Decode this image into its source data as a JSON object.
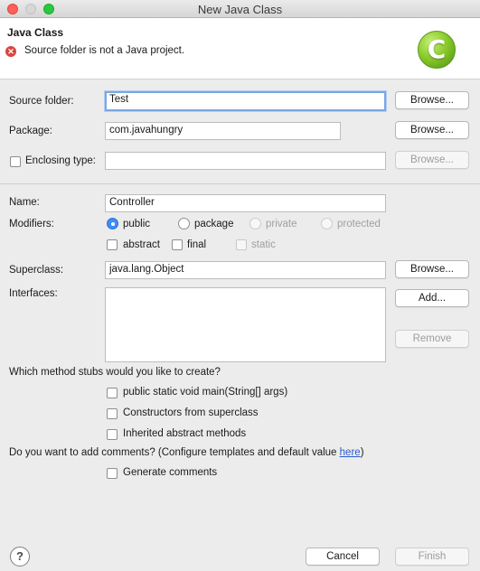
{
  "window": {
    "title": "New Java Class"
  },
  "header": {
    "title": "Java Class",
    "error_message": "Source folder is not a Java project.",
    "logo_letter": "C"
  },
  "source_folder": {
    "label": "Source folder:",
    "value": "Test",
    "browse_label": "Browse..."
  },
  "package": {
    "label": "Package:",
    "value": "com.javahungry",
    "browse_label": "Browse..."
  },
  "enclosing_type": {
    "label": "Enclosing type:",
    "value": "",
    "checked": false,
    "browse_label": "Browse..."
  },
  "name": {
    "label": "Name:",
    "value": "Controller"
  },
  "modifiers": {
    "label": "Modifiers:",
    "access": [
      {
        "label": "public",
        "selected": true,
        "enabled": true
      },
      {
        "label": "package",
        "selected": false,
        "enabled": true
      },
      {
        "label": "private",
        "selected": false,
        "enabled": false
      },
      {
        "label": "protected",
        "selected": false,
        "enabled": false
      }
    ],
    "flags": [
      {
        "label": "abstract",
        "checked": false,
        "enabled": true
      },
      {
        "label": "final",
        "checked": false,
        "enabled": true
      },
      {
        "label": "static",
        "checked": false,
        "enabled": false
      }
    ]
  },
  "superclass": {
    "label": "Superclass:",
    "value": "java.lang.Object",
    "browse_label": "Browse..."
  },
  "interfaces": {
    "label": "Interfaces:",
    "add_label": "Add...",
    "remove_label": "Remove"
  },
  "stubs": {
    "question": "Which method stubs would you like to create?",
    "options": [
      {
        "label": "public static void main(String[] args)",
        "checked": false
      },
      {
        "label": "Constructors from superclass",
        "checked": false
      },
      {
        "label": "Inherited abstract methods",
        "checked": false
      }
    ]
  },
  "comments": {
    "question_prefix": "Do you want to add comments? (Configure templates and default value ",
    "link": "here",
    "question_suffix": ")",
    "option": "Generate comments",
    "checked": false
  },
  "footer": {
    "help_symbol": "?",
    "cancel_label": "Cancel",
    "finish_label": "Finish"
  },
  "colors": {
    "accent": "#3f8cf6",
    "error": "#d9453d",
    "logo_green": "#8acb2c",
    "link": "#2a5ac9"
  }
}
